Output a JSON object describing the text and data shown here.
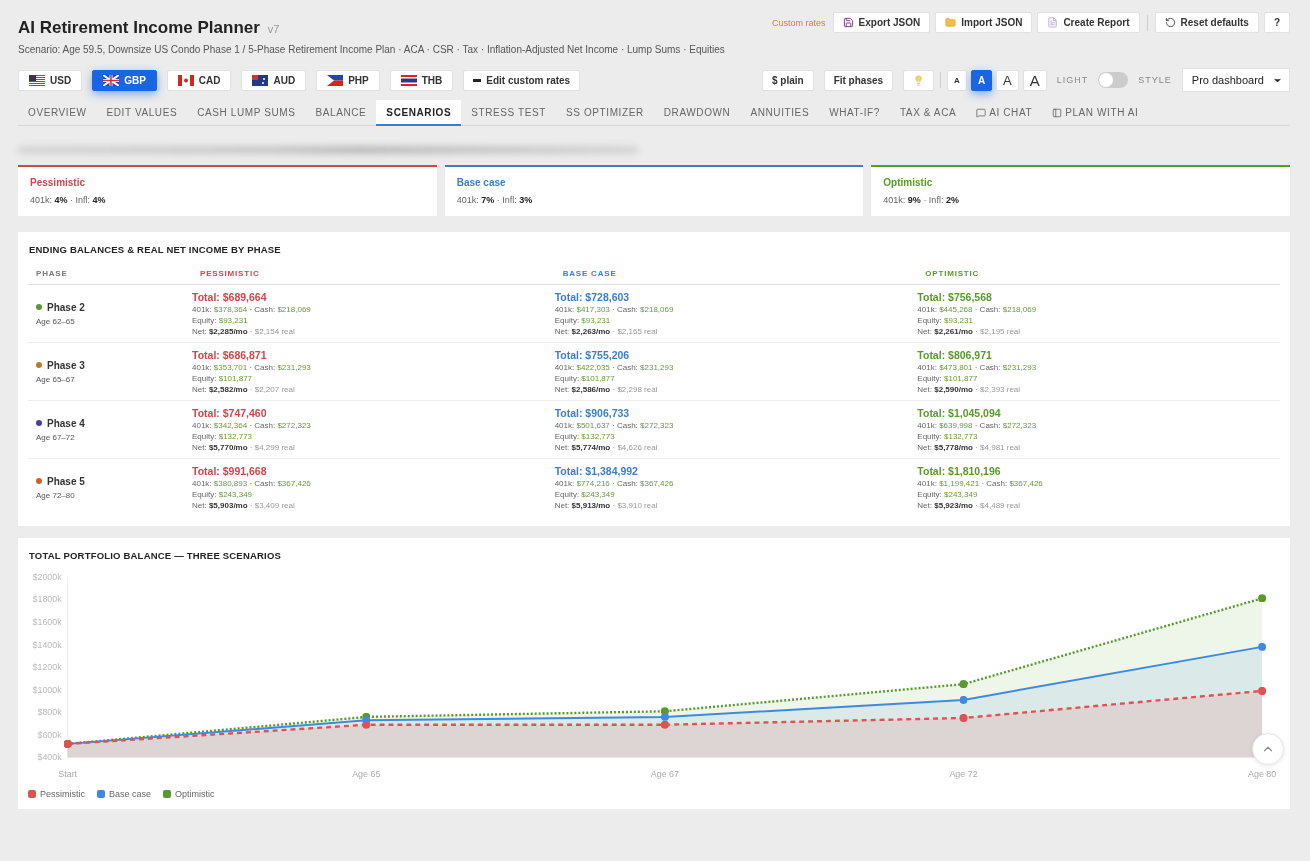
{
  "header": {
    "title": "AI Retirement Income Planner",
    "version": "v7",
    "subtitle": "Scenario: Age 59.5, Downsize US Condo Phase 1 / 5-Phase Retirement Income Plan · ACA · CSR · Tax · Inflation-Adjusted Net Income · Lump Sums · Equities",
    "custom_rates_label": "Custom rates",
    "actions": [
      {
        "label": "Export JSON",
        "kind": "save"
      },
      {
        "label": "Import JSON",
        "kind": "folder"
      },
      {
        "label": "Create Report",
        "kind": "report"
      },
      {
        "label": "Reset defaults",
        "kind": "reset"
      },
      {
        "label": "?",
        "kind": "help"
      }
    ]
  },
  "currencies": [
    {
      "code": "USD",
      "kind": "us",
      "selected": false
    },
    {
      "code": "GBP",
      "kind": "uk",
      "selected": true
    },
    {
      "code": "CAD",
      "kind": "ca",
      "selected": false
    },
    {
      "code": "AUD",
      "kind": "au",
      "selected": false
    },
    {
      "code": "PHP",
      "kind": "ph",
      "selected": false
    },
    {
      "code": "THB",
      "kind": "th",
      "selected": false
    }
  ],
  "edit_rates": "Edit custom rates",
  "tools": {
    "plain": "$ plain",
    "fit": "Fit phases",
    "font_sizes": [
      {
        "label": "A",
        "selected": false
      },
      {
        "label": "A",
        "selected": true
      },
      {
        "label": "A",
        "selected": false
      },
      {
        "label": "A",
        "selected": false
      }
    ],
    "light_label": "LIGHT",
    "light_on": false,
    "style_label": "STYLE",
    "style_value": "Pro dashboard"
  },
  "tabs": [
    {
      "label": "OVERVIEW",
      "selected": false
    },
    {
      "label": "EDIT VALUES",
      "selected": false
    },
    {
      "label": "CASH LUMP SUMS",
      "selected": false
    },
    {
      "label": "BALANCE",
      "selected": false
    },
    {
      "label": "SCENARIOS",
      "selected": true
    },
    {
      "label": "STRESS TEST",
      "selected": false
    },
    {
      "label": "SS OPTIMIZER",
      "selected": false
    },
    {
      "label": "DRAWDOWN",
      "selected": false
    },
    {
      "label": "ANNUITIES",
      "selected": false
    },
    {
      "label": "WHAT-IF?",
      "selected": false
    },
    {
      "label": "TAX & ACA",
      "selected": false
    },
    {
      "label": "AI CHAT",
      "selected": false,
      "kind": "chat"
    },
    {
      "label": "PLAN WITH AI",
      "selected": false,
      "kind": "panel"
    }
  ],
  "scenarios": [
    {
      "name": "Pessimistic",
      "color": "#d0464a",
      "detail": "401k: **4%** · Infl: **4%**"
    },
    {
      "name": "Base case",
      "color": "#3a7fcf",
      "detail": "401k: **7%** · Infl: **3%**"
    },
    {
      "name": "Optimistic",
      "color": "#5a9a2a",
      "detail": "401k: **9%** · Infl: **2%**"
    }
  ],
  "table": {
    "title": "ENDING BALANCES & REAL NET INCOME BY PHASE",
    "columns": [
      "PHASE",
      "PESSIMISTIC",
      "BASE CASE",
      "OPTIMISTIC"
    ],
    "rows": [
      {
        "cells": [
          {
            "phase": "Phase 2",
            "ages": "Age 62–65",
            "color": "#5a9a2a"
          },
          {
            "total": "Total: $689,664",
            "balances": "401k: *$378,364* · Cash: *$218,069*",
            "equity": "Equity: *$93,231*",
            "net": "Net: **$2,285/mo** *· $2,154 real*"
          },
          {
            "total": "Total: $728,603",
            "balances": "401k: *$417,303* · Cash: *$218,069*",
            "equity": "Equity: *$93,231*",
            "net": "Net: **$2,263/mo** *· $2,165 real*"
          },
          {
            "total": "Total: $756,568",
            "balances": "401k: *$445,268* · Cash: *$218,069*",
            "equity": "Equity: *$93,231*",
            "net": "Net: **$2,261/mo** *· $2,195 real*"
          }
        ]
      },
      {
        "cells": [
          {
            "phase": "Phase 3",
            "ages": "Age 65–67",
            "color": "#c07a1e"
          },
          {
            "total": "Total: $686,871",
            "balances": "401k: *$353,701* · Cash: *$231,293*",
            "equity": "Equity: *$101,877*",
            "net": "Net: **$2,582/mo** *· $2,207 real*"
          },
          {
            "total": "Total: $755,206",
            "balances": "401k: *$422,035* · Cash: *$231,293*",
            "equity": "Equity: *$101,877*",
            "net": "Net: **$2,586/mo** *· $2,298 real*"
          },
          {
            "total": "Total: $806,971",
            "balances": "401k: *$473,801* · Cash: *$231,293*",
            "equity": "Equity: *$101,877*",
            "net": "Net: **$2,590/mo** *· $2,393 real*"
          }
        ]
      },
      {
        "cells": [
          {
            "phase": "Phase 4",
            "ages": "Age 67–72",
            "color": "#4a3fa0"
          },
          {
            "total": "Total: $747,460",
            "balances": "401k: *$342,364* · Cash: *$272,323*",
            "equity": "Equity: *$132,773*",
            "net": "Net: **$5,770/mo** *· $4,299 real*"
          },
          {
            "total": "Total: $906,733",
            "balances": "401k: *$501,637* · Cash: *$272,323*",
            "equity": "Equity: *$132,773*",
            "net": "Net: **$5,774/mo** *· $4,626 real*"
          },
          {
            "total": "Total: $1,045,094",
            "balances": "401k: *$639,998* · Cash: *$272,323*",
            "equity": "Equity: *$132,773*",
            "net": "Net: **$5,778/mo** *· $4,981 real*"
          }
        ]
      },
      {
        "cells": [
          {
            "phase": "Phase 5",
            "ages": "Age 72–80",
            "color": "#d0602a"
          },
          {
            "total": "Total: $991,668",
            "balances": "401k: *$380,893* · Cash: *$367,426*",
            "equity": "Equity: *$243,349*",
            "net": "Net: **$5,903/mo** *· $3,409 real*"
          },
          {
            "total": "Total: $1,384,992",
            "balances": "401k: *$774,216* · Cash: *$367,426*",
            "equity": "Equity: *$243,349*",
            "net": "Net: **$5,913/mo** *· $3,910 real*"
          },
          {
            "total": "Total: $1,810,196",
            "balances": "401k: *$1,199,421* · Cash: *$367,426*",
            "equity": "Equity: *$243,349*",
            "net": "Net: **$5,923/mo** *· $4,489 real*"
          }
        ]
      }
    ]
  },
  "chart": {
    "title": "TOTAL PORTFOLIO BALANCE — THREE SCENARIOS",
    "chart_data": {
      "type": "area",
      "categories": [
        "Start",
        "Age 65",
        "Age 67",
        "Age 72",
        "Age 80"
      ],
      "series": [
        {
          "name": "Pessimistic",
          "color": "#e05252",
          "values": [
            520,
            690,
            690,
            750,
            990
          ]
        },
        {
          "name": "Base case",
          "color": "#3d8ae0",
          "values": [
            520,
            730,
            760,
            910,
            1380
          ]
        },
        {
          "name": "Optimistic",
          "color": "#5a9a2a",
          "values": [
            520,
            760,
            810,
            1050,
            1810
          ]
        }
      ],
      "ylim": [
        400,
        2000
      ],
      "yticks": [
        {
          "value": 400,
          "label": "$400k"
        },
        {
          "value": 600,
          "label": "$600k"
        },
        {
          "value": 800,
          "label": "$800k"
        },
        {
          "value": 1000,
          "label": "$1000k"
        },
        {
          "value": 1200,
          "label": "$1200k"
        },
        {
          "value": 1400,
          "label": "$1400k"
        },
        {
          "value": 1600,
          "label": "$1600k"
        },
        {
          "value": 1800,
          "label": "$1800k"
        },
        {
          "value": 2000,
          "label": "$2000k"
        }
      ]
    }
  }
}
